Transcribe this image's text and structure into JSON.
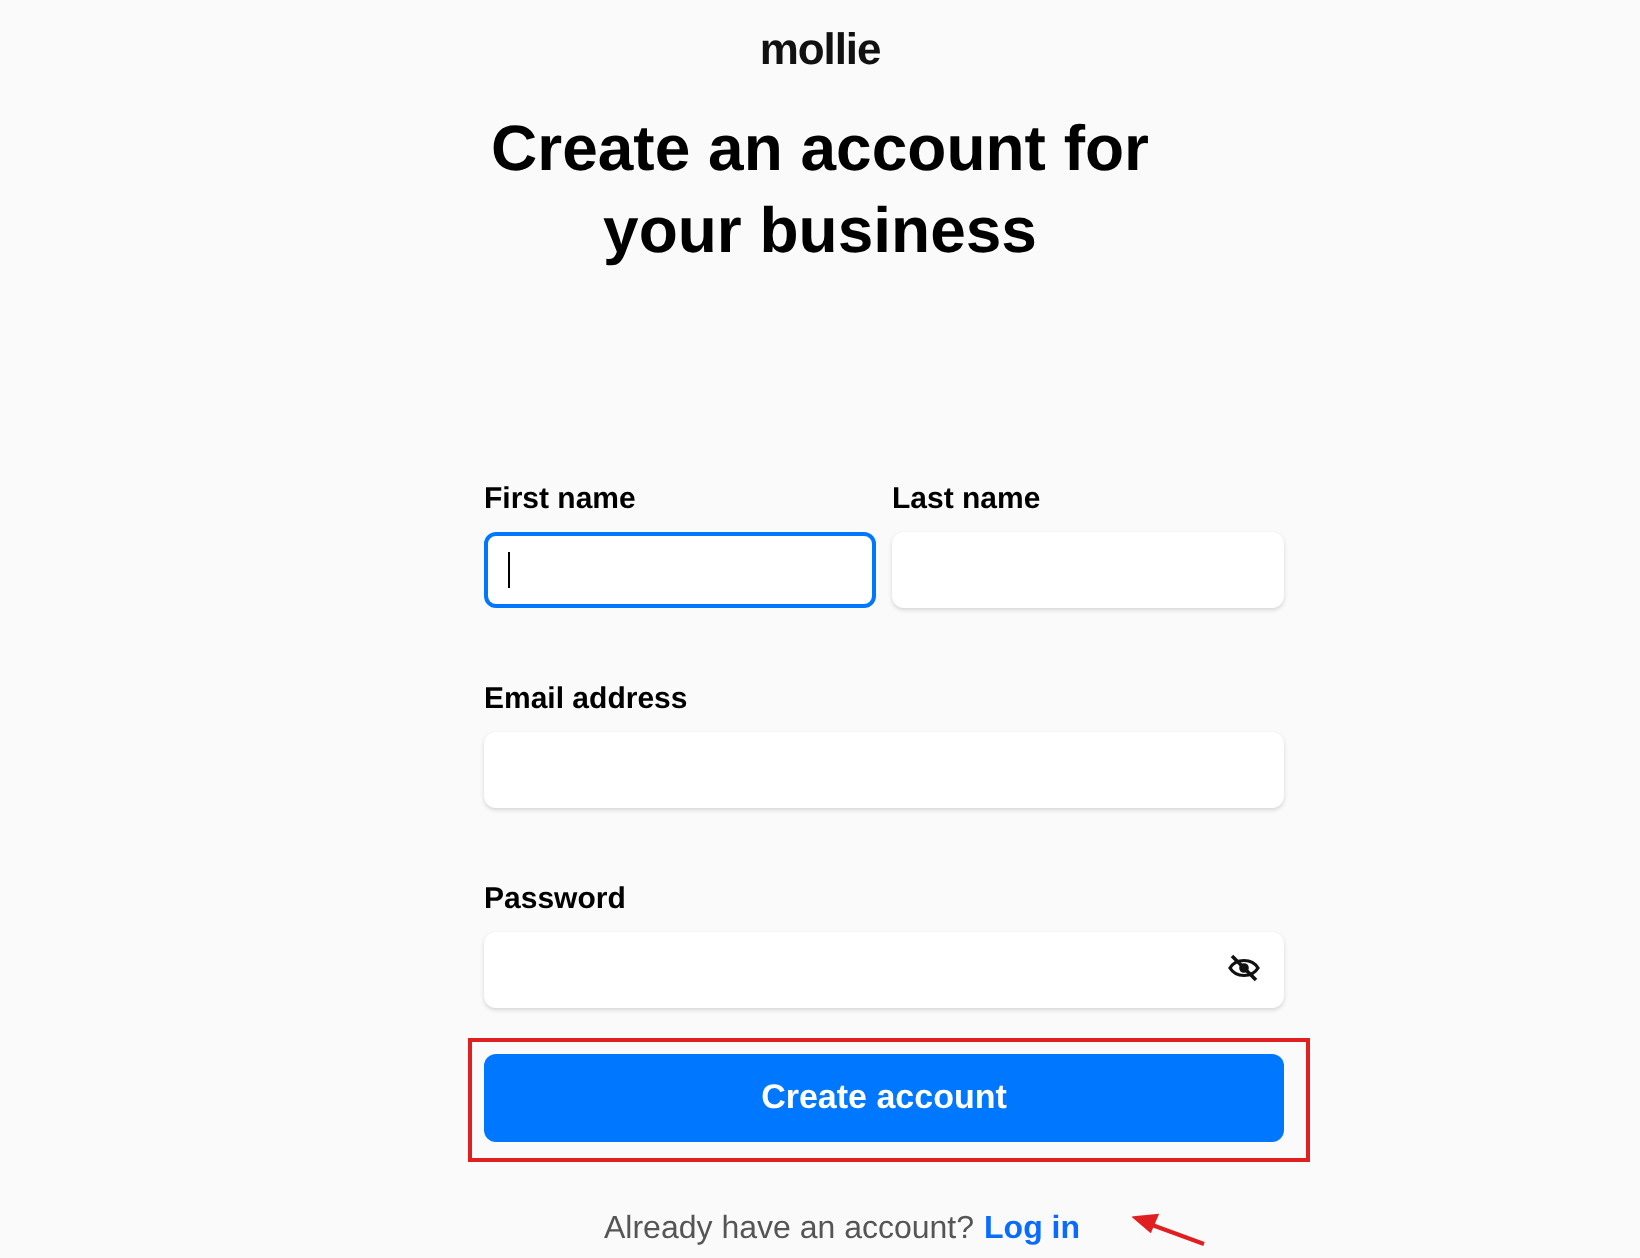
{
  "logo": "mollie",
  "heading": "Create an account for your business",
  "fields": [
    {
      "label": "First name",
      "focused": true,
      "kind": "text"
    },
    {
      "label": "Last name",
      "focused": false,
      "kind": "text"
    },
    {
      "label": "Email address",
      "focused": false,
      "kind": "text"
    },
    {
      "label": "Password",
      "focused": false,
      "kind": "password"
    }
  ],
  "submit_button": "Create account",
  "footer": {
    "text": "Already have an account?",
    "link": "Log in"
  }
}
